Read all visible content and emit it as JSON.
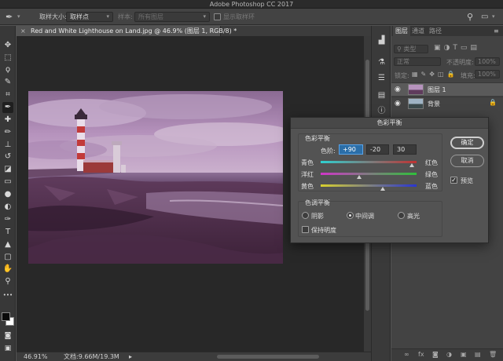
{
  "app_title": "Adobe Photoshop CC 2017",
  "options": {
    "sample_size_label": "取样大小:",
    "sample_size_value": "取样点",
    "sample_label": "样本:",
    "sample_value": "所有图层",
    "show_ring_label": "显示取样环"
  },
  "document": {
    "tab_title": "Red and White Lighthouse on Land.jpg @ 46.9% (图层 1, RGB/8) *",
    "close_glyph": "×"
  },
  "status": {
    "zoom": "46.91%",
    "doc_size": "文档:9.66M/19.3M",
    "arrow": "▸"
  },
  "tools": [
    {
      "name": "move-tool",
      "glyph": "✥"
    },
    {
      "name": "marquee-tool",
      "glyph": "⬚"
    },
    {
      "name": "lasso-tool",
      "glyph": "ϙ"
    },
    {
      "name": "quick-select-tool",
      "glyph": "✎"
    },
    {
      "name": "crop-tool",
      "glyph": "⌗"
    },
    {
      "name": "eyedropper-tool",
      "glyph": "✒"
    },
    {
      "name": "healing-brush-tool",
      "glyph": "✚"
    },
    {
      "name": "brush-tool",
      "glyph": "✏"
    },
    {
      "name": "clone-stamp-tool",
      "glyph": "⊥"
    },
    {
      "name": "history-brush-tool",
      "glyph": "↺"
    },
    {
      "name": "eraser-tool",
      "glyph": "◪"
    },
    {
      "name": "gradient-tool",
      "glyph": "▭"
    },
    {
      "name": "blur-tool",
      "glyph": "●"
    },
    {
      "name": "dodge-tool",
      "glyph": "◐"
    },
    {
      "name": "pen-tool",
      "glyph": "✑"
    },
    {
      "name": "type-tool",
      "glyph": "T"
    },
    {
      "name": "path-select-tool",
      "glyph": "▲"
    },
    {
      "name": "rectangle-tool",
      "glyph": "▢"
    },
    {
      "name": "hand-tool",
      "glyph": "✋"
    },
    {
      "name": "zoom-tool",
      "glyph": "⚲"
    },
    {
      "name": "more-tools",
      "glyph": "•••"
    }
  ],
  "layers_panel": {
    "tabs": [
      "图层",
      "通道",
      "路径"
    ],
    "filter_label": "类型",
    "blend_mode": "正常",
    "opacity_label": "不透明度:",
    "opacity_value": "100%",
    "lock_label": "锁定:",
    "fill_label": "填充:",
    "fill_value": "100%",
    "layers": [
      {
        "name": "图层 1",
        "selected": true
      },
      {
        "name": "背景",
        "selected": false
      }
    ],
    "footer_icons": [
      "∞",
      "fx",
      "◙",
      "◑",
      "▣",
      "▤",
      "🗑"
    ]
  },
  "color_balance_dialog": {
    "title": "色彩平衡",
    "balance_group_label": "色彩平衡",
    "levels_label": "色阶:",
    "levels": [
      "+90",
      "-20",
      "30"
    ],
    "sliders": [
      {
        "left": "青色",
        "right": "红色",
        "value": 90
      },
      {
        "left": "洋红",
        "right": "绿色",
        "value": -20
      },
      {
        "left": "黄色",
        "right": "蓝色",
        "value": 30
      }
    ],
    "tone_group_label": "色调平衡",
    "tones": [
      {
        "label": "阴影",
        "selected": false
      },
      {
        "label": "中间调",
        "selected": true
      },
      {
        "label": "高光",
        "selected": false
      }
    ],
    "preserve_luminosity_label": "保持明度",
    "preserve_luminosity_checked": false,
    "ok_label": "确定",
    "cancel_label": "取消",
    "preview_label": "预览",
    "preview_checked": true
  },
  "colors": {
    "focus_blue": "#2b6ea8",
    "photo_tint": "#8a5a86"
  }
}
